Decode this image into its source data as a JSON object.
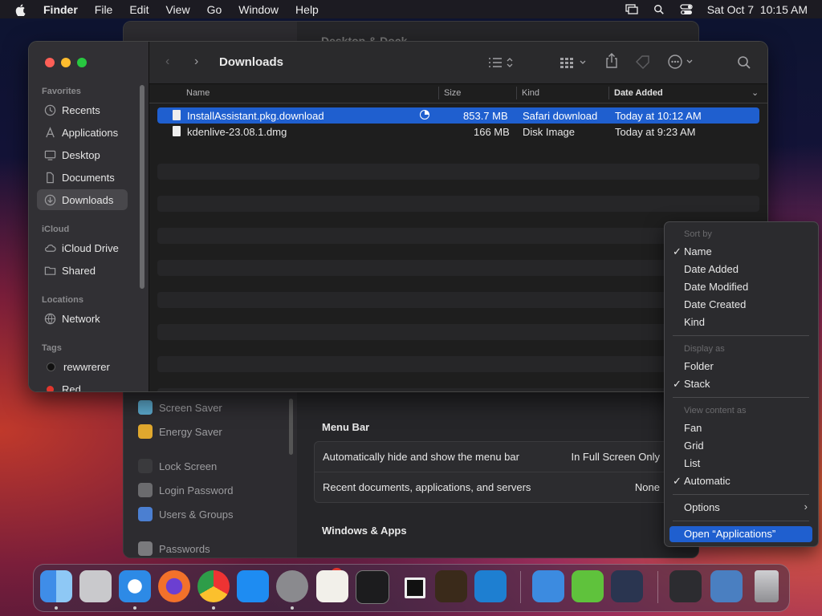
{
  "menubar": {
    "app": "Finder",
    "items": [
      "File",
      "Edit",
      "View",
      "Go",
      "Window",
      "Help"
    ],
    "datetime": "Sat Oct 7  10:15 AM"
  },
  "settings": {
    "title": "Desktop & Dock",
    "sidebar": [
      "Screen Saver",
      "Energy Saver",
      "Lock Screen",
      "Login Password",
      "Users & Groups",
      "Passwords"
    ],
    "menu_bar_section": "Menu Bar",
    "menu_bar_rows": [
      {
        "label": "Automatically hide and show the menu bar",
        "value": "In Full Screen Only"
      },
      {
        "label": "Recent documents, applications, and servers",
        "value": "None"
      }
    ],
    "windows_section": "Windows & Apps"
  },
  "finder": {
    "title": "Downloads",
    "sidebar": {
      "favorites_label": "Favorites",
      "favorites": [
        "Recents",
        "Applications",
        "Desktop",
        "Documents",
        "Downloads"
      ],
      "icloud_label": "iCloud",
      "icloud": [
        "iCloud Drive",
        "Shared"
      ],
      "locations_label": "Locations",
      "locations": [
        "Network"
      ],
      "tags_label": "Tags",
      "tags": [
        "rewwrerer",
        "Red"
      ]
    },
    "columns": {
      "name": "Name",
      "size": "Size",
      "kind": "Kind",
      "date": "Date Added"
    },
    "files": [
      {
        "name": "InstallAssistant.pkg.download",
        "size": "853.7 MB",
        "kind": "Safari download",
        "date": "Today at 10:12 AM"
      },
      {
        "name": "kdenlive-23.08.1.dmg",
        "size": "166 MB",
        "kind": "Disk Image",
        "date": "Today at 9:23 AM"
      }
    ]
  },
  "context_menu": {
    "sort_by_label": "Sort by",
    "sort": [
      "Name",
      "Date Added",
      "Date Modified",
      "Date Created",
      "Kind"
    ],
    "display_label": "Display as",
    "display": [
      "Folder",
      "Stack"
    ],
    "view_label": "View content as",
    "view": [
      "Fan",
      "Grid",
      "List",
      "Automatic"
    ],
    "options": "Options",
    "open": "Open “Applications”",
    "check": "✓",
    "chevron": "›"
  },
  "dock": {
    "badge": "1",
    "apps": [
      "finder-icon",
      "launchpad-icon",
      "safari-icon",
      "firefox-icon",
      "chrome-icon",
      "app-store-icon",
      "system-settings-icon",
      "textedit-icon",
      "terminal-icon",
      "square-app-icon",
      "garageband-icon",
      "vscode-icon",
      "weather-icon",
      "ot-app-icon",
      "media-app-icon",
      "downloads-stack-icon",
      "applications-stack-icon",
      "trash-icon"
    ]
  }
}
